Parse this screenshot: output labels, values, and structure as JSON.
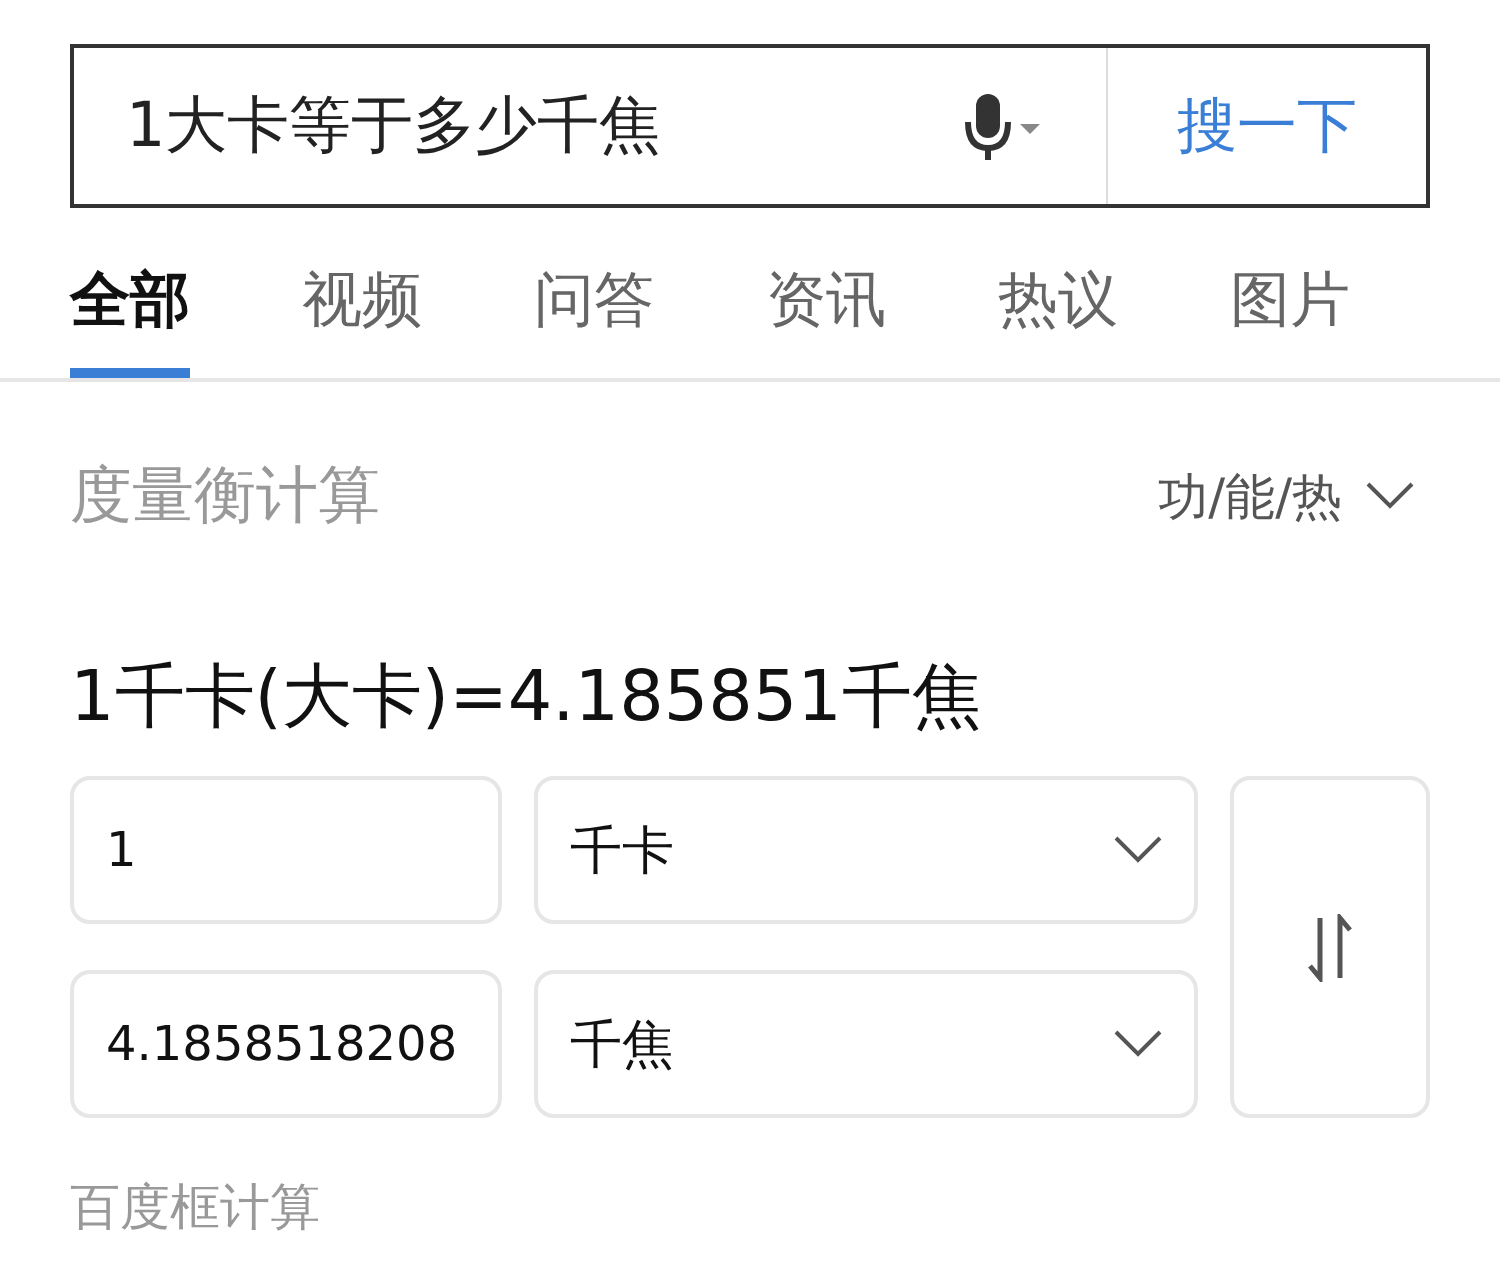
{
  "search": {
    "value": "1大卡等于多少千焦",
    "button": "搜一下"
  },
  "tabs": [
    {
      "label": "全部",
      "selected": true
    },
    {
      "label": "视频",
      "selected": false
    },
    {
      "label": "问答",
      "selected": false
    },
    {
      "label": "资讯",
      "selected": false
    },
    {
      "label": "热议",
      "selected": false
    },
    {
      "label": "图片",
      "selected": false
    }
  ],
  "converter": {
    "title": "度量衡计算",
    "category": "功/能/热",
    "result": "1千卡(大卡)=4.185851千焦",
    "rows": [
      {
        "value": "1",
        "unit": "千卡"
      },
      {
        "value": "4.1858518208",
        "unit": "千焦"
      }
    ],
    "source": "百度框计算"
  }
}
